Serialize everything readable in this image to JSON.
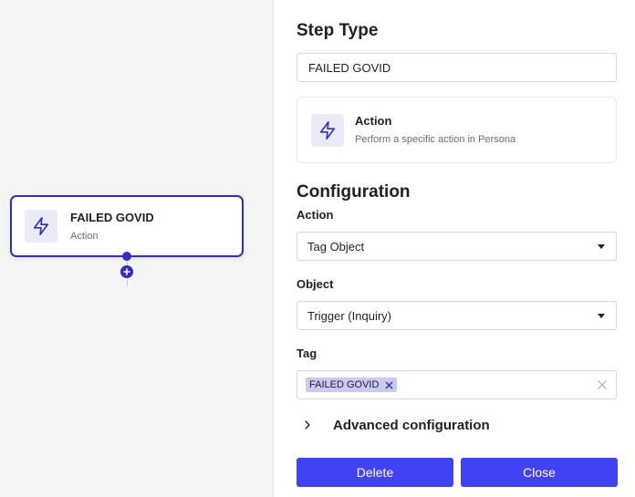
{
  "canvas": {
    "node": {
      "title": "FAILED GOVID",
      "subtitle": "Action",
      "icon": "lightning-icon"
    },
    "add_step_icon": "plus-circle-icon"
  },
  "panel": {
    "step_type": {
      "heading": "Step Type",
      "name_value": "FAILED GOVID",
      "card": {
        "title": "Action",
        "description": "Perform a specific action in Persona",
        "icon": "lightning-icon"
      }
    },
    "configuration": {
      "heading": "Configuration",
      "action": {
        "label": "Action",
        "value": "Tag Object"
      },
      "object": {
        "label": "Object",
        "value": "Trigger (Inquiry)"
      },
      "tag": {
        "label": "Tag",
        "tags": [
          "FAILED GOVID"
        ]
      }
    },
    "advanced": {
      "label": "Advanced configuration"
    },
    "buttons": {
      "delete": "Delete",
      "close": "Close"
    }
  },
  "colors": {
    "accent": "#2f2fc4",
    "button": "#4242f5",
    "chip": "#c9c9f6",
    "icon_bg": "#eaeaf9",
    "canvas_bg": "#f5f5f6"
  }
}
